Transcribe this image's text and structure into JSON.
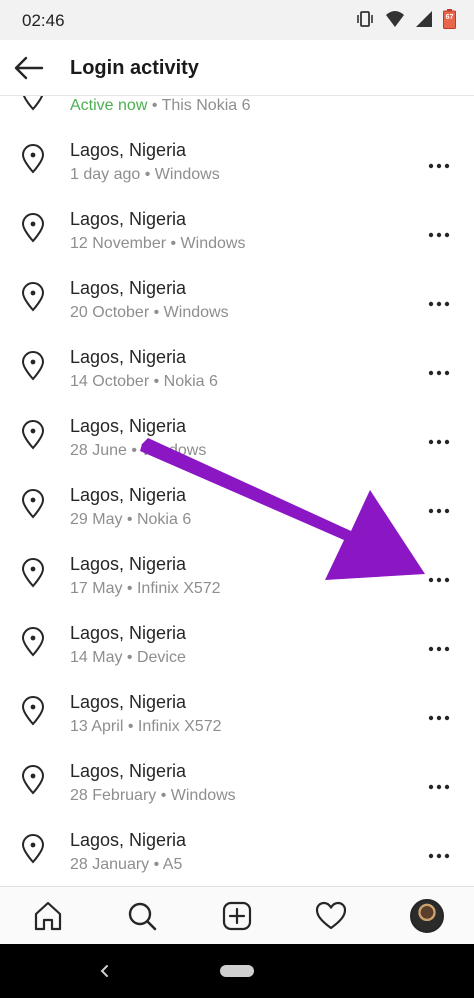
{
  "status_bar": {
    "time": "02:46",
    "battery_level": "67"
  },
  "header": {
    "title": "Login activity"
  },
  "current_session": {
    "status": "Active now",
    "separator": " • ",
    "device": "This Nokia 6"
  },
  "entries": [
    {
      "location": "Lagos, Nigeria",
      "date": "1 day ago",
      "device": "Windows"
    },
    {
      "location": "Lagos, Nigeria",
      "date": "12 November",
      "device": "Windows"
    },
    {
      "location": "Lagos, Nigeria",
      "date": "20 October",
      "device": "Windows"
    },
    {
      "location": "Lagos, Nigeria",
      "date": "14 October",
      "device": "Nokia 6"
    },
    {
      "location": "Lagos, Nigeria",
      "date": "28 June",
      "device": "Windows"
    },
    {
      "location": "Lagos, Nigeria",
      "date": "29 May",
      "device": "Nokia 6"
    },
    {
      "location": "Lagos, Nigeria",
      "date": "17 May",
      "device": "Infinix X572"
    },
    {
      "location": "Lagos, Nigeria",
      "date": "14 May",
      "device": "Device"
    },
    {
      "location": "Lagos, Nigeria",
      "date": "13 April",
      "device": "Infinix X572"
    },
    {
      "location": "Lagos, Nigeria",
      "date": "28 February",
      "device": "Windows"
    },
    {
      "location": "Lagos, Nigeria",
      "date": "28 January",
      "device": "A5"
    }
  ],
  "meta_separator": " • ",
  "icons": {
    "back": "arrow-left-icon",
    "pin": "location-pin-icon",
    "more": "more-horizontal-icon",
    "home": "home-icon",
    "search": "search-icon",
    "add": "add-post-icon",
    "activity": "heart-icon",
    "profile": "avatar"
  },
  "colors": {
    "active": "#4caf50",
    "annotation_arrow": "#8a16c4",
    "secondary_text": "#8e8e8e"
  }
}
